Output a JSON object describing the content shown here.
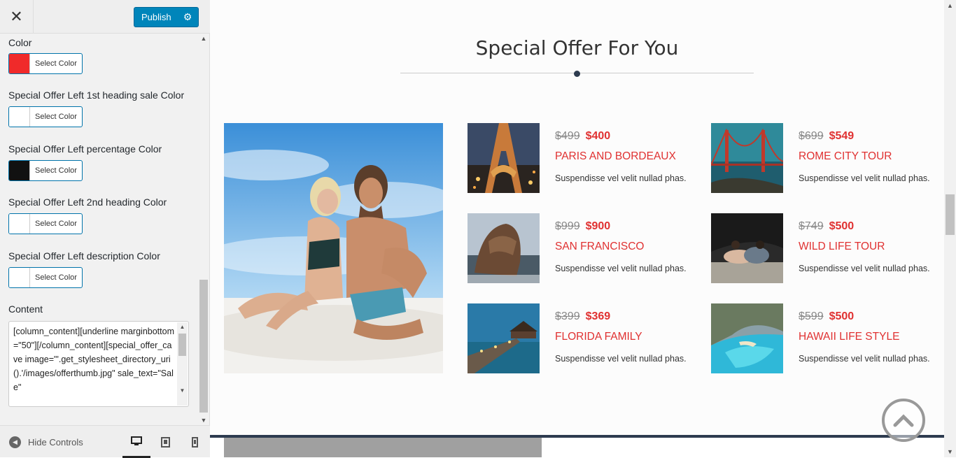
{
  "topbar": {
    "close_glyph": "✕",
    "publish_label": "Publish",
    "publish_icon": "gear-icon"
  },
  "controls": {
    "items": [
      {
        "label": "Color",
        "button": "Select Color",
        "swatch": "#f02a2a"
      },
      {
        "label": "Special Offer Left 1st heading sale Color",
        "button": "Select Color",
        "swatch": "#ffffff"
      },
      {
        "label": "Special Offer Left percentage Color",
        "button": "Select Color",
        "swatch": "#111111"
      },
      {
        "label": "Special Offer Left 2nd heading Color",
        "button": "Select Color",
        "swatch": "#ffffff"
      },
      {
        "label": "Special Offer Left description Color",
        "button": "Select Color",
        "swatch": "#ffffff"
      }
    ],
    "content_label": "Content",
    "content_value": "[column_content][underline marginbottom=\"50\"][/column_content][special_offer_cave image=\"'.get_stylesheet_directory_uri().'/images/offerthumb.jpg\" sale_text=\"Sale\""
  },
  "footer": {
    "hide_controls": "Hide Controls",
    "devices": [
      "desktop-icon",
      "tablet-icon",
      "mobile-icon"
    ]
  },
  "preview": {
    "title": "Special Offer For You",
    "offers": [
      {
        "old_price": "$499",
        "new_price": "$400",
        "name": "PARIS AND BORDEAUX",
        "desc": "Suspendisse vel velit nullad phas."
      },
      {
        "old_price": "$699",
        "new_price": "$549",
        "name": "ROME CITY TOUR",
        "desc": "Suspendisse vel velit nullad phas."
      },
      {
        "old_price": "$999",
        "new_price": "$900",
        "name": "SAN FRANCISCO",
        "desc": "Suspendisse vel velit nullad phas."
      },
      {
        "old_price": "$749",
        "new_price": "$500",
        "name": "WILD LIFE TOUR",
        "desc": "Suspendisse vel velit nullad phas."
      },
      {
        "old_price": "$399",
        "new_price": "$369",
        "name": "FLORIDA FAMILY",
        "desc": "Suspendisse vel velit nullad phas."
      },
      {
        "old_price": "$599",
        "new_price": "$500",
        "name": "HAWAII LIFE STYLE",
        "desc": "Suspendisse vel velit nullad phas."
      }
    ]
  },
  "colors": {
    "accent": "#0085ba",
    "price_red": "#e03131",
    "dark_navy": "#2d3b4f"
  }
}
